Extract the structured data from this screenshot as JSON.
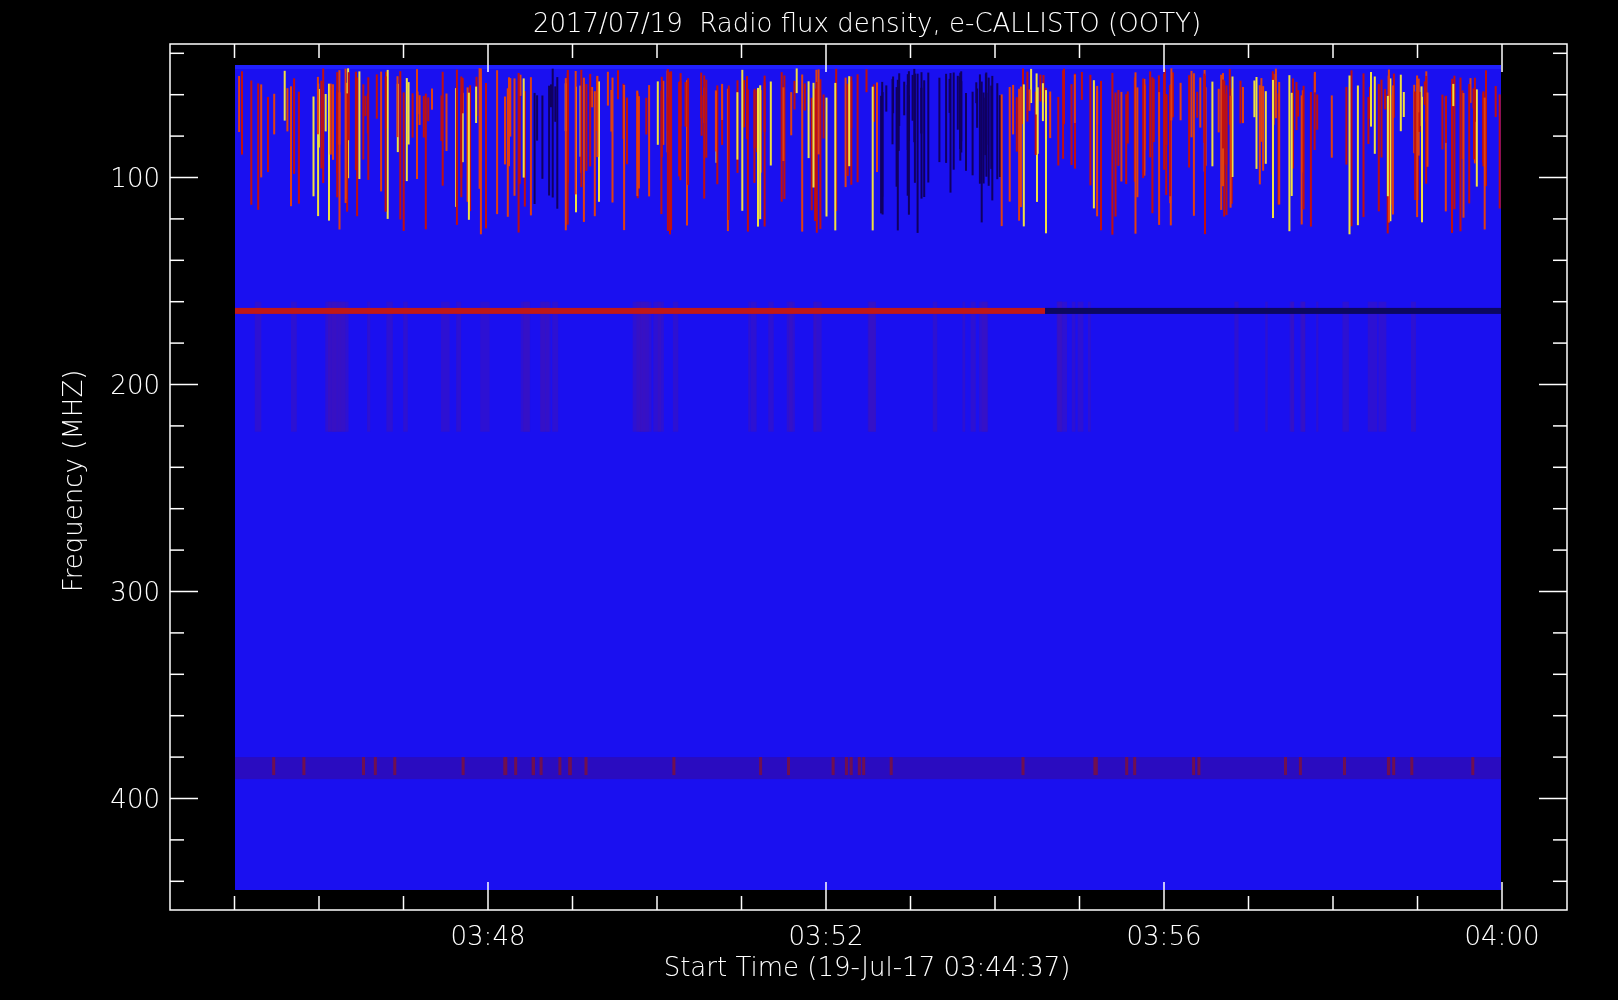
{
  "plot": {
    "title": "2017/07/19  Radio flux density, e-CALLISTO (OOTY)",
    "ylabel": "Frequency (MHZ)",
    "xlabel": "Start Time (19-Jul-17 03:44:37)",
    "yticks": [
      "100",
      "200",
      "300",
      "400"
    ],
    "xticks": [
      "03:48",
      "03:52",
      "03:56",
      "04:00"
    ]
  }
}
